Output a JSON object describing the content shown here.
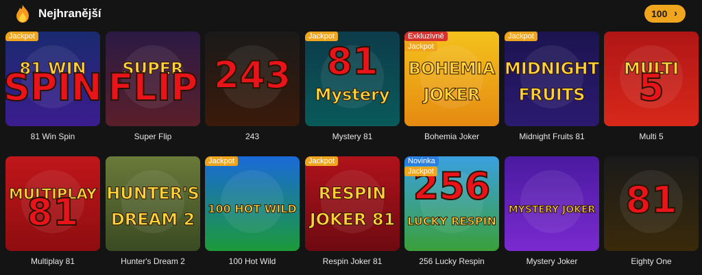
{
  "section": {
    "title": "Nejhranější",
    "count_label": "100",
    "chevron": "›",
    "icon": "flame-icon"
  },
  "games": [
    {
      "name": "81 Win Spin",
      "badges": [
        "Jackpot"
      ],
      "art": [
        "81 WIN",
        "SPIN"
      ],
      "colors": [
        "#1a2a6e",
        "#3b1d8f"
      ]
    },
    {
      "name": "Super Flip",
      "badges": [],
      "art": [
        "SUPER",
        "FLIP"
      ],
      "colors": [
        "#2b1a44",
        "#5a1f2a"
      ]
    },
    {
      "name": "243",
      "badges": [],
      "art": [
        "243",
        ""
      ],
      "colors": [
        "#1a1a1a",
        "#3a1a0a"
      ]
    },
    {
      "name": "Mystery 81",
      "badges": [
        "Jackpot"
      ],
      "art": [
        "81",
        "Mystery"
      ],
      "colors": [
        "#0d3b4a",
        "#0a5a5a"
      ]
    },
    {
      "name": "Bohemia Joker",
      "badges": [
        "Exkluzivně",
        "Jackpot"
      ],
      "art": [
        "BOHEMIA",
        "JOKER"
      ],
      "colors": [
        "#f4c21c",
        "#e58a12"
      ]
    },
    {
      "name": "Midnight Fruits 81",
      "badges": [
        "Jackpot"
      ],
      "art": [
        "MIDNIGHT",
        "FRUITS"
      ],
      "colors": [
        "#1c1450",
        "#2b1a70"
      ]
    },
    {
      "name": "Multi 5",
      "badges": [],
      "art": [
        "MULTI",
        "5"
      ],
      "colors": [
        "#b01616",
        "#d8281a"
      ]
    },
    {
      "name": "Multiplay 81",
      "badges": [],
      "art": [
        "MULTIPLAY",
        "81"
      ],
      "colors": [
        "#c0161a",
        "#8e0d10"
      ]
    },
    {
      "name": "Hunter's Dream 2",
      "badges": [],
      "art": [
        "HUNTER'S",
        "DREAM 2"
      ],
      "colors": [
        "#6a7a3a",
        "#3a4a22"
      ]
    },
    {
      "name": "100 Hot Wild",
      "badges": [
        "Jackpot"
      ],
      "art": [
        "100 HOT WILD",
        ""
      ],
      "colors": [
        "#1a6ad8",
        "#1c9a3a"
      ]
    },
    {
      "name": "Respin Joker 81",
      "badges": [
        "Jackpot"
      ],
      "art": [
        "RESPIN",
        "JOKER 81"
      ],
      "colors": [
        "#b0121a",
        "#6e0a12"
      ]
    },
    {
      "name": "256 Lucky Respin",
      "badges": [
        "Novinka",
        "Jackpot"
      ],
      "art": [
        "256",
        "LUCKY RESPIN"
      ],
      "colors": [
        "#3aa0e0",
        "#3aa03a"
      ]
    },
    {
      "name": "Mystery Joker",
      "badges": [],
      "art": [
        "MYSTERY JOKER",
        ""
      ],
      "colors": [
        "#4a1aa0",
        "#7a2ad0"
      ]
    },
    {
      "name": "Eighty One",
      "badges": [],
      "art": [
        "81",
        ""
      ],
      "colors": [
        "#1a1a1a",
        "#3a2a0a"
      ]
    }
  ]
}
